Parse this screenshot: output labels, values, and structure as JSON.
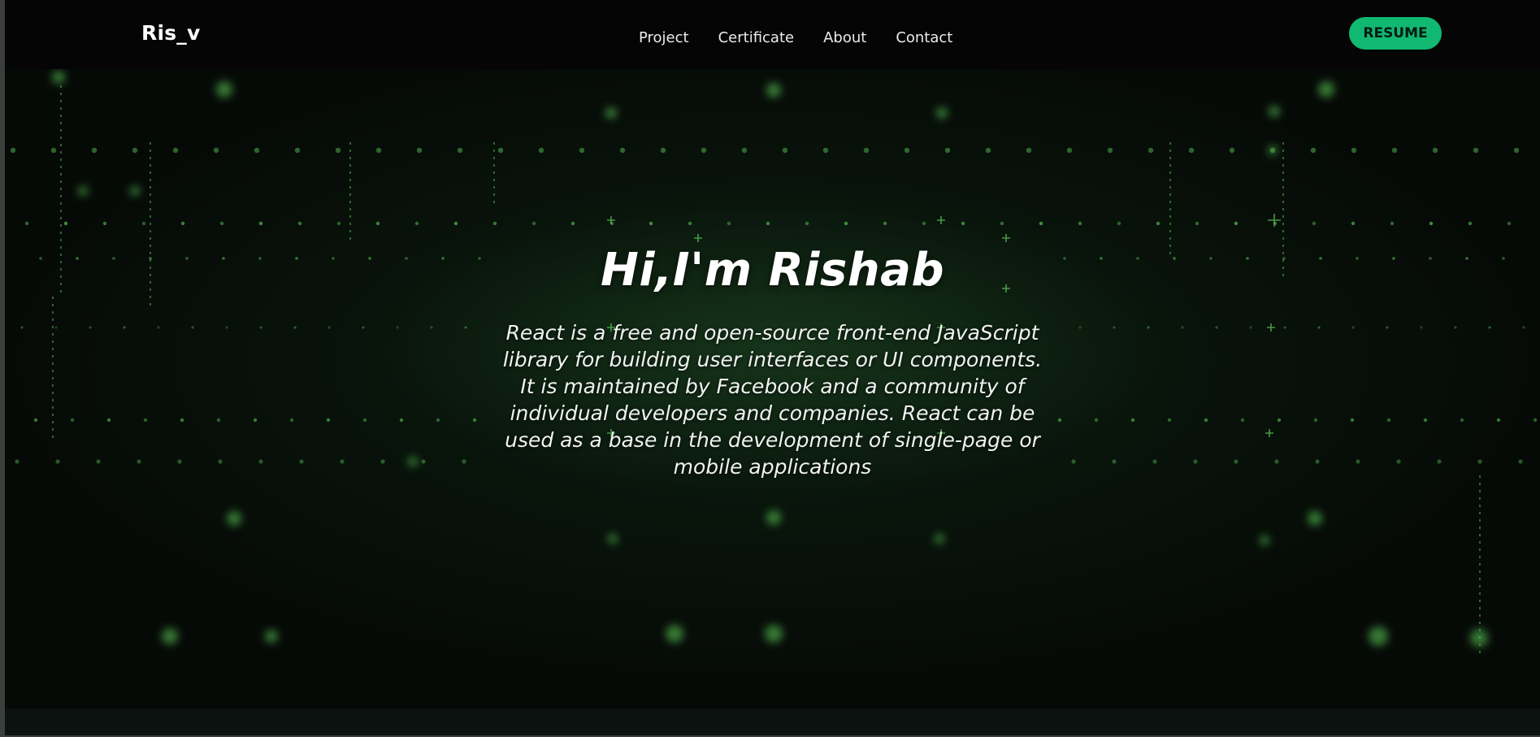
{
  "navbar": {
    "brand": "Ris_v",
    "links": [
      "Project",
      "Certificate",
      "About",
      "Contact"
    ],
    "resume_label": "RESUME"
  },
  "hero": {
    "title": "Hi,I'm Rishab",
    "description": "React is a free and open-source front-end JavaScript library for building user interfaces or UI components. It is maintained by Facebook and a community of individual developers and companies. React can be used as a base in the development of single-page or mobile applications"
  },
  "colors": {
    "accent": "#11b871",
    "background": "#070a08",
    "particle": "#5fd35a"
  }
}
